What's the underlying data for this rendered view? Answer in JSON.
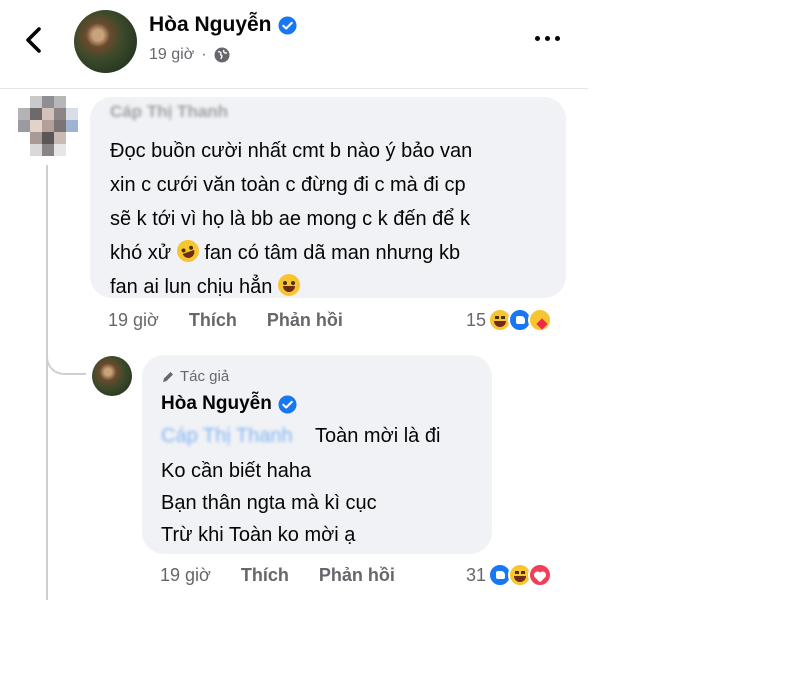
{
  "header": {
    "back_icon": "chevron-left-icon",
    "name": "Hòa Nguyễn",
    "verified_icon": "verified-badge-icon",
    "time": "19 giờ",
    "globe_icon": "globe-icon",
    "more_icon": "more-horizontal-icon"
  },
  "comment": {
    "author": "Cáp Thị Thanh",
    "lines": [
      "Đọc buồn cười nhất cmt b nào ý bảo van",
      "xin c cưới văn toàn c đừng đi c mà đi cp",
      "sẽ k tới vì họ là bb ae mong c k đến để k",
      "khó xử",
      "fan có tâm dã man nhưng kb",
      "fan ai lun chịu hẳn"
    ],
    "time": "19 giờ",
    "like_label": "Thích",
    "reply_label": "Phản hồi",
    "reaction_count": "15",
    "reactions": [
      "haha",
      "like",
      "care"
    ]
  },
  "reply": {
    "author_tag": "Tác giả",
    "author_icon": "pencil-icon",
    "name": "Hòa Nguyễn",
    "mention": "Cáp Thị Thanh",
    "first_line": "Toàn mời là đi",
    "lines": [
      "Ko cần biết haha",
      "Bạn thân ngta mà kì cục",
      "Trừ khi Toàn ko mời ạ"
    ],
    "time": "19 giờ",
    "like_label": "Thích",
    "reply_label": "Phản hồi",
    "reaction_count": "31",
    "reactions": [
      "like",
      "haha",
      "love"
    ]
  },
  "colors": {
    "bubble": "#f0f2f5",
    "secondary_text": "#65676b",
    "link_blue": "#1877f2"
  }
}
